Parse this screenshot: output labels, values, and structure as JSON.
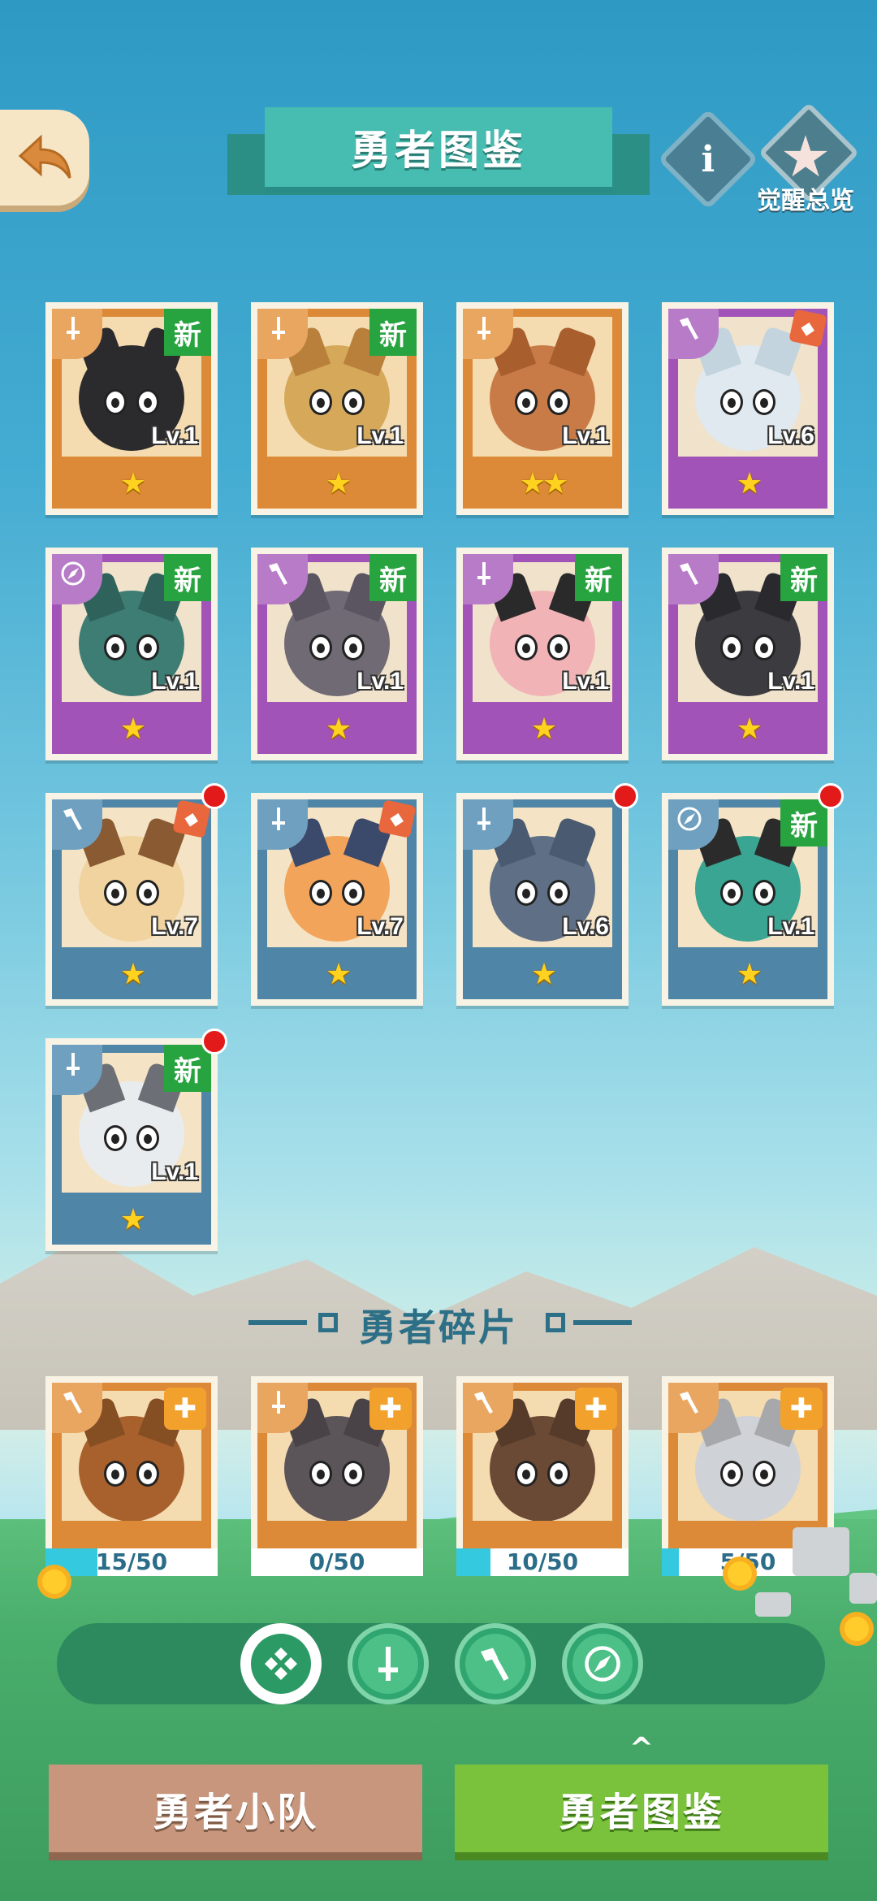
{
  "header": {
    "title": "勇者图鉴",
    "awaken_label": "觉醒总览",
    "info_symbol": "i"
  },
  "heroes": [
    {
      "color": "orange",
      "class": "sword",
      "new": true,
      "level": "Lv.1",
      "stars": 1,
      "red_dot": false,
      "tag": false,
      "face": "#2b2b2e",
      "ear": "#2b2b2e"
    },
    {
      "color": "orange",
      "class": "sword",
      "new": true,
      "level": "Lv.1",
      "stars": 1,
      "red_dot": false,
      "tag": false,
      "face": "#d6a85a",
      "ear": "#b9803c"
    },
    {
      "color": "orange",
      "class": "sword",
      "new": false,
      "level": "Lv.1",
      "stars": 2,
      "red_dot": false,
      "tag": false,
      "face": "#c87b46",
      "ear": "#a95e2e"
    },
    {
      "color": "purple",
      "class": "hammer",
      "new": false,
      "level": "Lv.6",
      "stars": 1,
      "red_dot": false,
      "tag": true,
      "face": "#dfe9ef",
      "ear": "#c3d4de"
    },
    {
      "color": "purple",
      "class": "compass",
      "new": true,
      "level": "Lv.1",
      "stars": 1,
      "red_dot": false,
      "tag": false,
      "face": "#3e7d74",
      "ear": "#2e625b"
    },
    {
      "color": "purple",
      "class": "hammer",
      "new": true,
      "level": "Lv.1",
      "stars": 1,
      "red_dot": false,
      "tag": false,
      "face": "#6f6a74",
      "ear": "#5a5560"
    },
    {
      "color": "purple",
      "class": "sword",
      "new": true,
      "level": "Lv.1",
      "stars": 1,
      "red_dot": false,
      "tag": false,
      "face": "#f2b3b6",
      "ear": "#2a2a2a"
    },
    {
      "color": "purple",
      "class": "hammer",
      "new": true,
      "level": "Lv.1",
      "stars": 1,
      "red_dot": false,
      "tag": false,
      "face": "#3b3b40",
      "ear": "#2a2a2e"
    },
    {
      "color": "blue",
      "class": "hammer",
      "new": false,
      "level": "Lv.7",
      "stars": 1,
      "red_dot": true,
      "tag": true,
      "face": "#f0d39e",
      "ear": "#8a5a33"
    },
    {
      "color": "blue",
      "class": "sword",
      "new": false,
      "level": "Lv.7",
      "stars": 1,
      "red_dot": false,
      "tag": true,
      "face": "#f2a45a",
      "ear": "#3b4a6b"
    },
    {
      "color": "blue",
      "class": "sword",
      "new": false,
      "level": "Lv.6",
      "stars": 1,
      "red_dot": true,
      "tag": false,
      "face": "#5e6f86",
      "ear": "#4a5a70"
    },
    {
      "color": "blue",
      "class": "compass",
      "new": true,
      "level": "Lv.1",
      "stars": 1,
      "red_dot": true,
      "tag": false,
      "face": "#3aa592",
      "ear": "#2b2b2b"
    },
    {
      "color": "blue",
      "class": "sword",
      "new": true,
      "level": "Lv.1",
      "stars": 1,
      "red_dot": true,
      "tag": false,
      "face": "#e9ecef",
      "ear": "#6c6f75"
    }
  ],
  "new_label": "新",
  "star_glyph": "★",
  "fragments_title": "勇者碎片",
  "fragments": [
    {
      "class": "hammer",
      "progress": "15/50",
      "value": 15,
      "max": 50,
      "face": "#a8612c"
    },
    {
      "class": "sword",
      "progress": "0/50",
      "value": 0,
      "max": 50,
      "face": "#5b5459"
    },
    {
      "class": "hammer",
      "progress": "10/50",
      "value": 10,
      "max": 50,
      "face": "#6b4a35"
    },
    {
      "class": "hammer",
      "progress": "5/50",
      "value": 5,
      "max": 50,
      "face": "#cfd2d6"
    }
  ],
  "fragment_puzzle_glyph": "✚",
  "filters": [
    {
      "id": "all",
      "active": true
    },
    {
      "id": "sword",
      "active": false
    },
    {
      "id": "hammer",
      "active": false
    },
    {
      "id": "compass",
      "active": false
    }
  ],
  "tabs": {
    "team": "勇者小队",
    "dex": "勇者图鉴",
    "chevron": "^"
  },
  "colors": {
    "new_badge": "#27a33f",
    "progress_fill": "#35c9e0",
    "tab_active": "#7ac13c",
    "tab_inactive": "#c7967c"
  }
}
